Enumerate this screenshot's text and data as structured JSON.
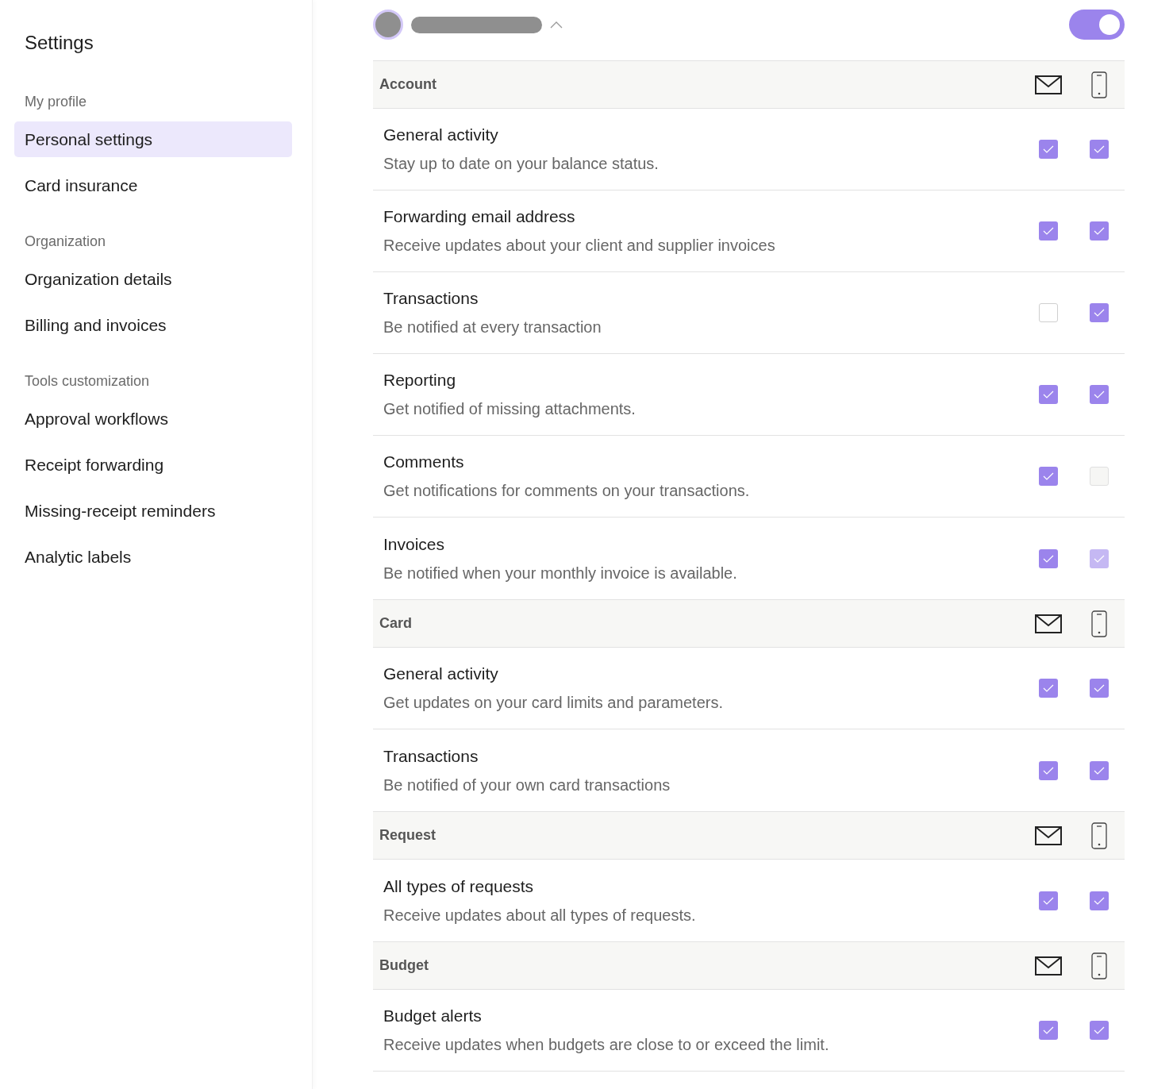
{
  "sidebar": {
    "title": "Settings",
    "groups": [
      {
        "heading": "My profile",
        "items": [
          {
            "label": "Personal settings",
            "selected": true
          },
          {
            "label": "Card insurance",
            "selected": false
          }
        ]
      },
      {
        "heading": "Organization",
        "items": [
          {
            "label": "Organization details",
            "selected": false
          },
          {
            "label": "Billing and invoices",
            "selected": false
          }
        ]
      },
      {
        "heading": "Tools customization",
        "items": [
          {
            "label": "Approval workflows",
            "selected": false
          },
          {
            "label": "Receipt forwarding",
            "selected": false
          },
          {
            "label": "Missing-receipt reminders",
            "selected": false
          },
          {
            "label": "Analytic labels",
            "selected": false
          }
        ]
      }
    ]
  },
  "header": {
    "toggle": {
      "on": true
    }
  },
  "sections": [
    {
      "title": "Account",
      "rows": [
        {
          "title": "General activity",
          "description": "Stay up to date on your balance status.",
          "email": {
            "checked": true,
            "disabled": false
          },
          "mobile": {
            "checked": true,
            "disabled": false
          }
        },
        {
          "title": "Forwarding email address",
          "description": "Receive updates about your client and supplier invoices",
          "email": {
            "checked": true,
            "disabled": false
          },
          "mobile": {
            "checked": true,
            "disabled": false
          }
        },
        {
          "title": "Transactions",
          "description": "Be notified at every transaction",
          "email": {
            "checked": false,
            "disabled": false
          },
          "mobile": {
            "checked": true,
            "disabled": false
          }
        },
        {
          "title": "Reporting",
          "description": "Get notified of missing attachments.",
          "email": {
            "checked": true,
            "disabled": false
          },
          "mobile": {
            "checked": true,
            "disabled": false
          }
        },
        {
          "title": "Comments",
          "description": "Get notifications for comments on your transactions.",
          "email": {
            "checked": true,
            "disabled": false
          },
          "mobile": {
            "checked": false,
            "disabled": true
          }
        },
        {
          "title": "Invoices",
          "description": "Be notified when your monthly invoice is available.",
          "email": {
            "checked": true,
            "disabled": false
          },
          "mobile": {
            "checked": true,
            "disabled": true
          }
        }
      ]
    },
    {
      "title": "Card",
      "rows": [
        {
          "title": "General activity",
          "description": "Get updates on your card limits and parameters.",
          "email": {
            "checked": true,
            "disabled": false
          },
          "mobile": {
            "checked": true,
            "disabled": false
          }
        },
        {
          "title": "Transactions",
          "description": "Be notified of your own card transactions",
          "email": {
            "checked": true,
            "disabled": false
          },
          "mobile": {
            "checked": true,
            "disabled": false
          }
        }
      ]
    },
    {
      "title": "Request",
      "rows": [
        {
          "title": "All types of requests",
          "description": "Receive updates about all types of requests.",
          "email": {
            "checked": true,
            "disabled": false
          },
          "mobile": {
            "checked": true,
            "disabled": false
          }
        }
      ]
    },
    {
      "title": "Budget",
      "rows": [
        {
          "title": "Budget alerts",
          "description": "Receive updates when budgets are close to or exceed the limit.",
          "email": {
            "checked": true,
            "disabled": false
          },
          "mobile": {
            "checked": true,
            "disabled": false
          }
        }
      ]
    }
  ]
}
